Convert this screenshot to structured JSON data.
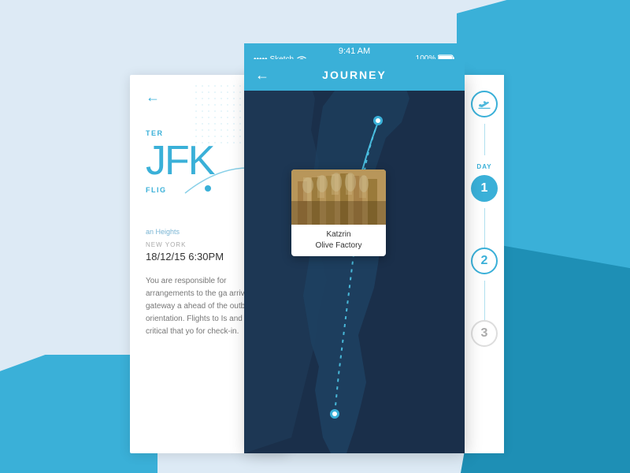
{
  "app": {
    "title": "JOURNEY",
    "status_bar": {
      "signals": "•••••",
      "carrier": "Sketch",
      "wifi": "wifi",
      "time": "9:41 AM",
      "battery": "100%"
    }
  },
  "left_panel": {
    "back_arrow": "←",
    "terminal_label": "TER",
    "airport_code": "JFK",
    "flight_label": "FLIG",
    "location": "NEW YORK",
    "date_time": "18/12/15 6:30PM",
    "description": "You are responsible for arrangements to the ga arrive at the gateway a ahead of the outbound orientation. Flights to Is and it is critical that yo for check-in.",
    "heights_label": "an Heights"
  },
  "map": {
    "popup": {
      "location_name": "Katzrin",
      "location_sub": "Olive Factory"
    }
  },
  "timeline": {
    "icon_label": "plane-landing-icon",
    "day_label": "DAY",
    "days": [
      {
        "number": "1",
        "active": true
      },
      {
        "number": "2",
        "active": false
      },
      {
        "number": "3",
        "dim": true
      }
    ]
  }
}
